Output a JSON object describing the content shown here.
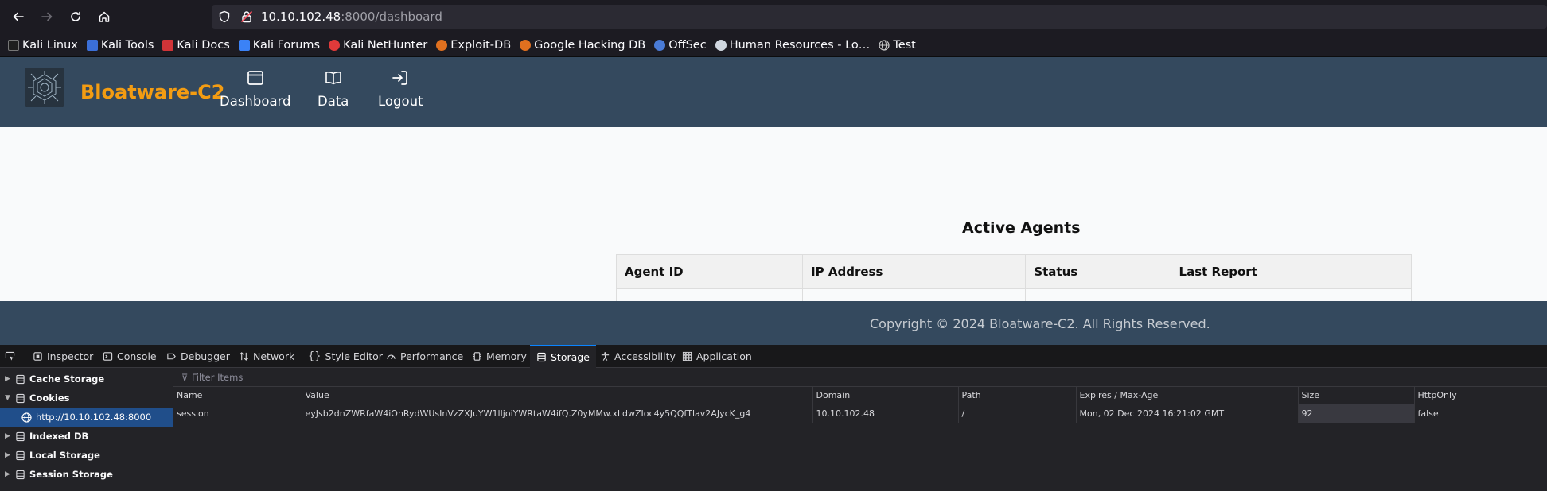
{
  "browser": {
    "url_host": "10.10.102.48",
    "url_path": ":8000/dashboard",
    "bookmarks": [
      {
        "label": "Kali Linux",
        "color": "#1e1e1e"
      },
      {
        "label": "Kali Tools",
        "color": "#3b6fd8"
      },
      {
        "label": "Kali Docs",
        "color": "#d13438"
      },
      {
        "label": "Kali Forums",
        "color": "#3b82f6"
      },
      {
        "label": "Kali NetHunter",
        "color": "#e03a3a"
      },
      {
        "label": "Exploit-DB",
        "color": "#e0701f"
      },
      {
        "label": "Google Hacking DB",
        "color": "#e0701f"
      },
      {
        "label": "OffSec",
        "color": "#4a7bd6"
      },
      {
        "label": "Human Resources - Lo…",
        "color": "#d0d7e0"
      },
      {
        "label": "Test",
        "color": "#c8c8c8"
      }
    ]
  },
  "site": {
    "brand": "Bloatware-C2",
    "menu": {
      "dashboard": "Dashboard",
      "data": "Data",
      "logout": "Logout"
    },
    "agents_title": "Active Agents",
    "agents_headers": [
      "Agent ID",
      "IP Address",
      "Status",
      "Last Report"
    ],
    "copyright": "Copyright © 2024 Bloatware-C2. All Rights Reserved.",
    "colors": {
      "header": "#34495e",
      "brand": "#f39c12"
    }
  },
  "devtools": {
    "tabs": [
      "Inspector",
      "Console",
      "Debugger",
      "Network",
      "Style Editor",
      "Performance",
      "Memory",
      "Storage",
      "Accessibility",
      "Application"
    ],
    "active_tab": "Storage",
    "tree": {
      "cache_storage": "Cache Storage",
      "cookies": "Cookies",
      "cookie_origin": "http://10.10.102.48:8000",
      "indexed_db": "Indexed DB",
      "local_storage": "Local Storage",
      "session_storage": "Session Storage"
    },
    "filter_placeholder": "Filter Items",
    "columns": [
      "Name",
      "Value",
      "Domain",
      "Path",
      "Expires / Max-Age",
      "Size",
      "HttpOnly"
    ],
    "cookie": {
      "name": "session",
      "value": "eyJsb2dnZWRfaW4iOnRydWUsInVzZXJuYW1lIjoiYWRtaW4ifQ.Z0yMMw.xLdwZIoc4y5QQfTlav2AJycK_g4",
      "domain": "10.10.102.48",
      "path": "/",
      "expires": "Mon, 02 Dec 2024 16:21:02 GMT",
      "size": "92",
      "httponly": "false"
    }
  }
}
